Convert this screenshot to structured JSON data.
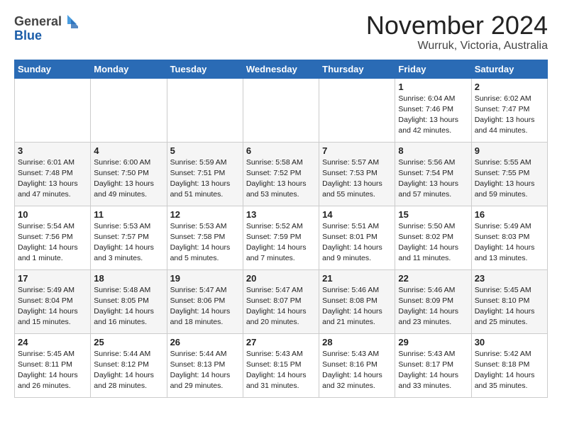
{
  "header": {
    "logo_general": "General",
    "logo_blue": "Blue",
    "title": "November 2024",
    "subtitle": "Wurruk, Victoria, Australia"
  },
  "calendar": {
    "weekdays": [
      "Sunday",
      "Monday",
      "Tuesday",
      "Wednesday",
      "Thursday",
      "Friday",
      "Saturday"
    ],
    "weeks": [
      [
        {
          "day": "",
          "info": ""
        },
        {
          "day": "",
          "info": ""
        },
        {
          "day": "",
          "info": ""
        },
        {
          "day": "",
          "info": ""
        },
        {
          "day": "",
          "info": ""
        },
        {
          "day": "1",
          "info": "Sunrise: 6:04 AM\nSunset: 7:46 PM\nDaylight: 13 hours\nand 42 minutes."
        },
        {
          "day": "2",
          "info": "Sunrise: 6:02 AM\nSunset: 7:47 PM\nDaylight: 13 hours\nand 44 minutes."
        }
      ],
      [
        {
          "day": "3",
          "info": "Sunrise: 6:01 AM\nSunset: 7:48 PM\nDaylight: 13 hours\nand 47 minutes."
        },
        {
          "day": "4",
          "info": "Sunrise: 6:00 AM\nSunset: 7:50 PM\nDaylight: 13 hours\nand 49 minutes."
        },
        {
          "day": "5",
          "info": "Sunrise: 5:59 AM\nSunset: 7:51 PM\nDaylight: 13 hours\nand 51 minutes."
        },
        {
          "day": "6",
          "info": "Sunrise: 5:58 AM\nSunset: 7:52 PM\nDaylight: 13 hours\nand 53 minutes."
        },
        {
          "day": "7",
          "info": "Sunrise: 5:57 AM\nSunset: 7:53 PM\nDaylight: 13 hours\nand 55 minutes."
        },
        {
          "day": "8",
          "info": "Sunrise: 5:56 AM\nSunset: 7:54 PM\nDaylight: 13 hours\nand 57 minutes."
        },
        {
          "day": "9",
          "info": "Sunrise: 5:55 AM\nSunset: 7:55 PM\nDaylight: 13 hours\nand 59 minutes."
        }
      ],
      [
        {
          "day": "10",
          "info": "Sunrise: 5:54 AM\nSunset: 7:56 PM\nDaylight: 14 hours\nand 1 minute."
        },
        {
          "day": "11",
          "info": "Sunrise: 5:53 AM\nSunset: 7:57 PM\nDaylight: 14 hours\nand 3 minutes."
        },
        {
          "day": "12",
          "info": "Sunrise: 5:53 AM\nSunset: 7:58 PM\nDaylight: 14 hours\nand 5 minutes."
        },
        {
          "day": "13",
          "info": "Sunrise: 5:52 AM\nSunset: 7:59 PM\nDaylight: 14 hours\nand 7 minutes."
        },
        {
          "day": "14",
          "info": "Sunrise: 5:51 AM\nSunset: 8:01 PM\nDaylight: 14 hours\nand 9 minutes."
        },
        {
          "day": "15",
          "info": "Sunrise: 5:50 AM\nSunset: 8:02 PM\nDaylight: 14 hours\nand 11 minutes."
        },
        {
          "day": "16",
          "info": "Sunrise: 5:49 AM\nSunset: 8:03 PM\nDaylight: 14 hours\nand 13 minutes."
        }
      ],
      [
        {
          "day": "17",
          "info": "Sunrise: 5:49 AM\nSunset: 8:04 PM\nDaylight: 14 hours\nand 15 minutes."
        },
        {
          "day": "18",
          "info": "Sunrise: 5:48 AM\nSunset: 8:05 PM\nDaylight: 14 hours\nand 16 minutes."
        },
        {
          "day": "19",
          "info": "Sunrise: 5:47 AM\nSunset: 8:06 PM\nDaylight: 14 hours\nand 18 minutes."
        },
        {
          "day": "20",
          "info": "Sunrise: 5:47 AM\nSunset: 8:07 PM\nDaylight: 14 hours\nand 20 minutes."
        },
        {
          "day": "21",
          "info": "Sunrise: 5:46 AM\nSunset: 8:08 PM\nDaylight: 14 hours\nand 21 minutes."
        },
        {
          "day": "22",
          "info": "Sunrise: 5:46 AM\nSunset: 8:09 PM\nDaylight: 14 hours\nand 23 minutes."
        },
        {
          "day": "23",
          "info": "Sunrise: 5:45 AM\nSunset: 8:10 PM\nDaylight: 14 hours\nand 25 minutes."
        }
      ],
      [
        {
          "day": "24",
          "info": "Sunrise: 5:45 AM\nSunset: 8:11 PM\nDaylight: 14 hours\nand 26 minutes."
        },
        {
          "day": "25",
          "info": "Sunrise: 5:44 AM\nSunset: 8:12 PM\nDaylight: 14 hours\nand 28 minutes."
        },
        {
          "day": "26",
          "info": "Sunrise: 5:44 AM\nSunset: 8:13 PM\nDaylight: 14 hours\nand 29 minutes."
        },
        {
          "day": "27",
          "info": "Sunrise: 5:43 AM\nSunset: 8:15 PM\nDaylight: 14 hours\nand 31 minutes."
        },
        {
          "day": "28",
          "info": "Sunrise: 5:43 AM\nSunset: 8:16 PM\nDaylight: 14 hours\nand 32 minutes."
        },
        {
          "day": "29",
          "info": "Sunrise: 5:43 AM\nSunset: 8:17 PM\nDaylight: 14 hours\nand 33 minutes."
        },
        {
          "day": "30",
          "info": "Sunrise: 5:42 AM\nSunset: 8:18 PM\nDaylight: 14 hours\nand 35 minutes."
        }
      ]
    ]
  }
}
